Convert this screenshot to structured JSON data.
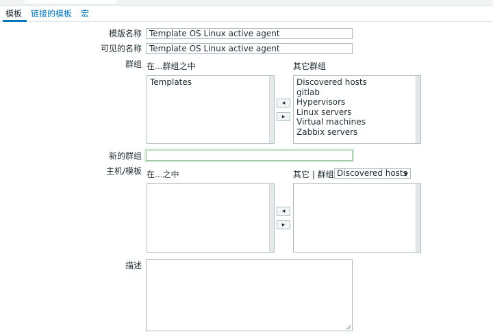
{
  "tabs": [
    {
      "label": "模板",
      "active": true
    },
    {
      "label": "链接的模板",
      "active": false
    },
    {
      "label": "宏",
      "active": false
    }
  ],
  "form": {
    "template_name_label": "模版名称",
    "template_name_value": "Template OS Linux active agent",
    "visible_name_label": "可见的名称",
    "visible_name_value": "Template OS Linux active agent",
    "groups_label": "群组",
    "groups_in_label": "在...群组之中",
    "groups_in_items": [
      "Templates"
    ],
    "groups_other_label": "其它群组",
    "groups_other_items": [
      "Discovered hosts",
      "gitlab",
      "Hypervisors",
      "Linux servers",
      "Virtual machines",
      "Zabbix servers"
    ],
    "new_group_label": "新的群组",
    "new_group_value": "",
    "hosts_label": "主机/模板",
    "hosts_in_label": "在...之中",
    "hosts_other_label": "其它 | 群组",
    "hosts_group_select": "Discovered hosts",
    "hosts_in_items": [],
    "hosts_other_items": [],
    "description_label": "描述",
    "description_value": ""
  },
  "icons": {
    "move_left": "arrow-left-icon",
    "move_right": "arrow-right-icon",
    "dropdown": "chevron-down-icon",
    "resize": "resize-grip-icon"
  },
  "colors": {
    "link": "#0275b8",
    "focus_border": "#9fc8a0"
  }
}
